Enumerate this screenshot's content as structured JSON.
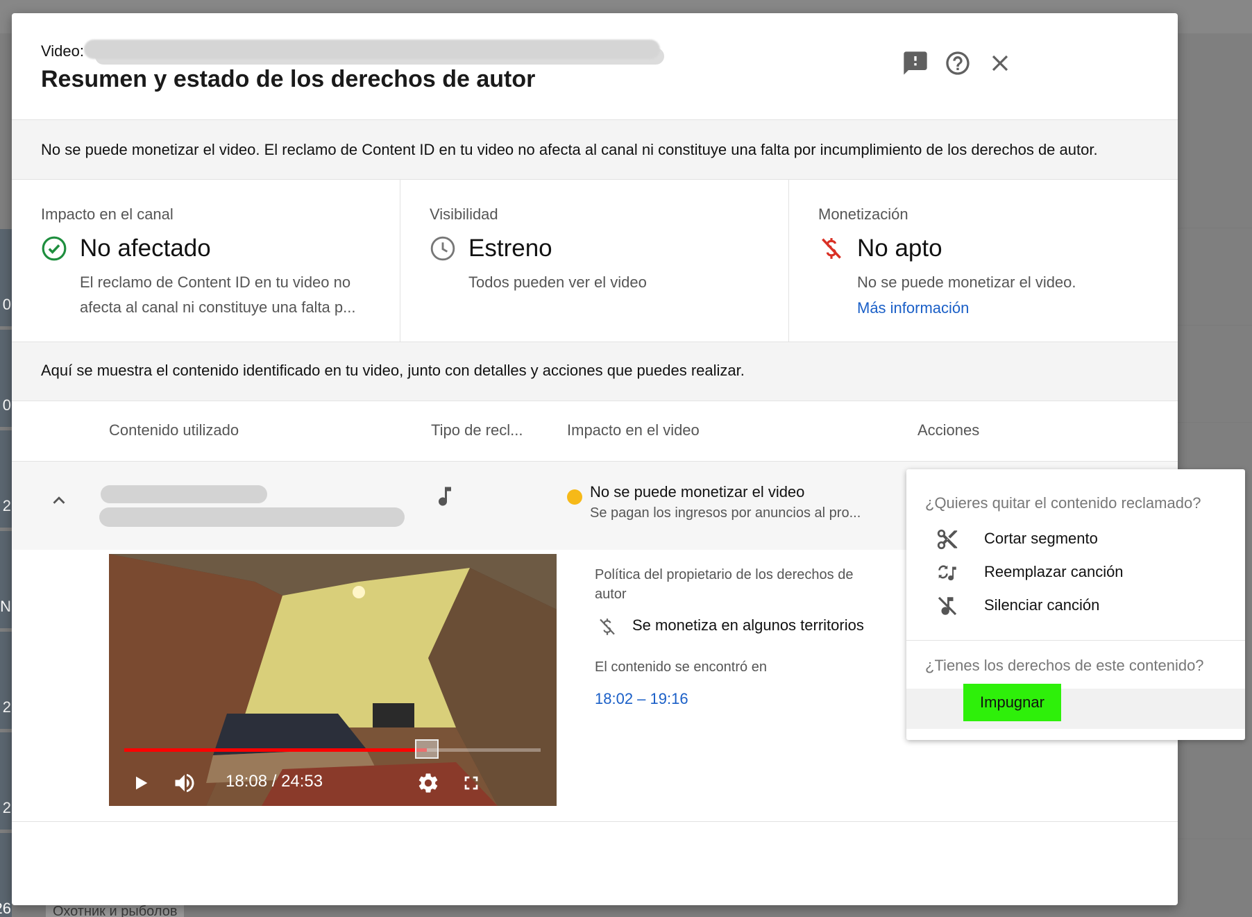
{
  "background": {
    "thumb_numbers": [
      "0",
      "0",
      "2",
      "N",
      "2",
      "2",
      "26"
    ],
    "footer_text": "Охотник и рыболов"
  },
  "modal": {
    "video_label": "Video:",
    "title": "Resumen y estado de los derechos de autor",
    "icons": [
      "feedback-icon",
      "help-icon",
      "close-icon"
    ]
  },
  "notice": "No se puede monetizar el video. El reclamo de Content ID en tu video no afecta al canal ni constituye una falta por incumplimiento de los derechos de autor.",
  "cards": {
    "channel": {
      "label": "Impacto en el canal",
      "value": "No afectado",
      "desc": "El reclamo de Content ID en tu video no afecta al canal ni constituye una falta p...",
      "icon": "check-circle-icon",
      "color": "#1e8e3e"
    },
    "visibility": {
      "label": "Visibilidad",
      "value": "Estreno",
      "desc": "Todos pueden ver el video",
      "icon": "clock-icon"
    },
    "monetization": {
      "label": "Monetización",
      "value": "No apto",
      "desc": "No se puede monetizar el video.",
      "link": "Más información",
      "icon": "no-money-icon",
      "color": "#d93025"
    }
  },
  "info_strip": "Aquí se muestra el contenido identificado en tu video, junto con detalles y acciones que puedes realizar.",
  "table": {
    "headers": {
      "content": "Contenido utilizado",
      "claim_type": "Tipo de recl...",
      "impact": "Impacto en el video",
      "actions": "Acciones"
    },
    "row": {
      "claim_icon": "music-note-icon",
      "impact_title": "No se puede monetizar el video",
      "impact_sub": "Se pagan los ingresos por anuncios al pro...",
      "status_color": "#f6b918"
    }
  },
  "details": {
    "policy_label": "Política del propietario de los derechos de autor",
    "policy_text": "Se monetiza en algunos territorios",
    "found_label": "El contenido se encontró en",
    "found_range": "18:02 – 19:16"
  },
  "player": {
    "time": "18:08 / 24:53",
    "progress": 0.727
  },
  "menu": {
    "remove_heading": "¿Quieres quitar el contenido reclamado?",
    "items": [
      {
        "label": "Cortar segmento",
        "icon": "scissors-icon"
      },
      {
        "label": "Reemplazar canción",
        "icon": "replace-song-icon"
      },
      {
        "label": "Silenciar canción",
        "icon": "mute-song-icon"
      }
    ],
    "rights_heading": "¿Tienes los derechos de este contenido?",
    "dispute_label": "Impugnar",
    "dispute_color": "#2ef00a"
  }
}
